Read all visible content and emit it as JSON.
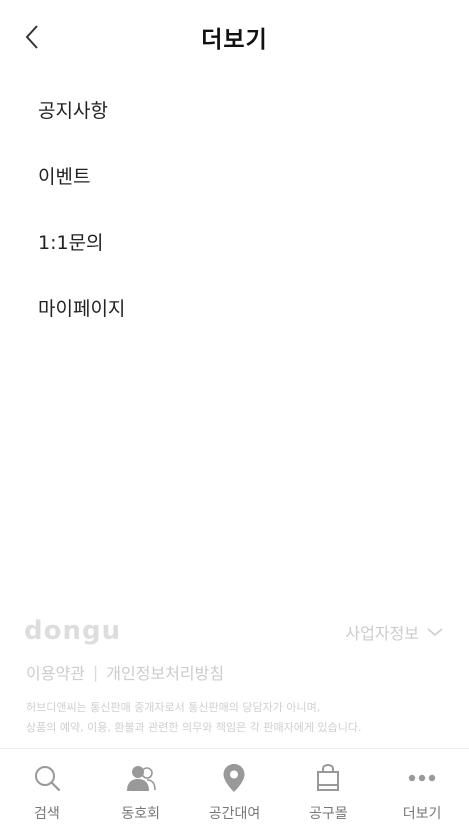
{
  "header": {
    "title": "더보기"
  },
  "menu": [
    {
      "label": "공지사항"
    },
    {
      "label": "이벤트"
    },
    {
      "label": "1:1문의"
    },
    {
      "label": "마이페이지"
    }
  ],
  "footer": {
    "logo": "dongu",
    "business_info": "사업자정보",
    "links": [
      "이용약관",
      "개인정보처리방침"
    ],
    "notice_line1": "허브디앤씨는 통신판매 중개자로서 통신판매의 당담자가 아니며,",
    "notice_line2": "상품의 예약, 이용, 환불과 관련한 의무와 책임은 각 판매자에게 있습니다."
  },
  "tabbar": [
    {
      "label": "검색",
      "icon": "search-icon"
    },
    {
      "label": "동호회",
      "icon": "people-icon"
    },
    {
      "label": "공간대여",
      "icon": "location-pin-icon"
    },
    {
      "label": "공구몰",
      "icon": "shopping-bag-icon"
    },
    {
      "label": "더보기",
      "icon": "more-dots-icon"
    }
  ],
  "colors": {
    "text": "#222222",
    "muted": "#cccccc",
    "icon": "#999999"
  }
}
